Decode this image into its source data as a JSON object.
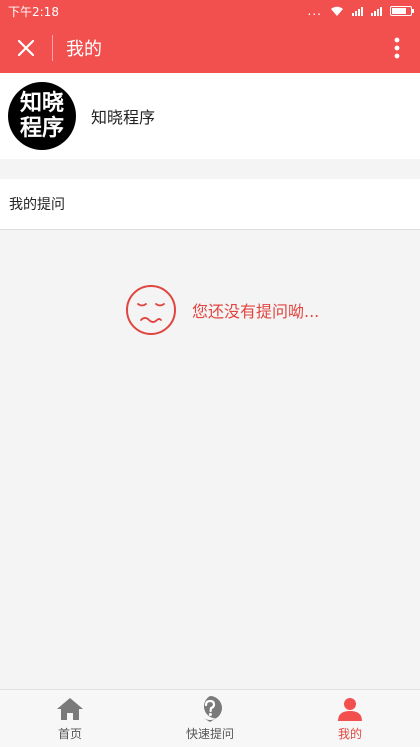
{
  "status_bar": {
    "time": "下午2:18",
    "dots": "..."
  },
  "nav": {
    "title": "我的"
  },
  "profile": {
    "avatar_line1": "知晓",
    "avatar_line2": "程序",
    "name": "知晓程序"
  },
  "questions": {
    "header": "我的提问"
  },
  "empty_state": {
    "message": "您还没有提问呦..."
  },
  "tab_bar": {
    "tabs": [
      {
        "label": "首页",
        "icon": "home-icon"
      },
      {
        "label": "快速提问",
        "icon": "question-icon"
      },
      {
        "label": "我的",
        "icon": "user-icon",
        "active": true
      }
    ]
  },
  "colors": {
    "brand": "#f24f4f",
    "accent_text": "#e0453f",
    "inactive_icon": "#7a7a7a"
  }
}
